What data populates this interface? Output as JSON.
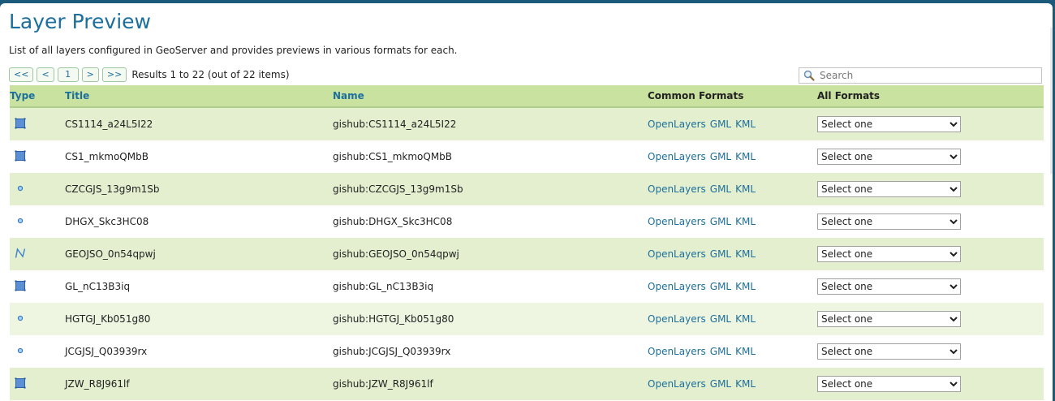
{
  "page": {
    "title": "Layer Preview",
    "description": "List of all layers configured in GeoServer and provides previews in various formats for each."
  },
  "pager": {
    "first": "<<",
    "prev": "<",
    "page": "1",
    "next": ">",
    "last": ">>",
    "results": "Results 1 to 22 (out of 22 items)"
  },
  "search": {
    "placeholder": "Search",
    "icon": "magnifier-icon"
  },
  "table": {
    "headers": {
      "type": "Type",
      "title": "Title",
      "name": "Name",
      "common_formats": "Common Formats",
      "all_formats": "All Formats"
    },
    "format_links": {
      "openlayers": "OpenLayers",
      "gml": "GML",
      "kml": "KML"
    },
    "select_default": "Select one",
    "rows": [
      {
        "type_icon": "polygon-layer-icon",
        "title": "CS1114_a24L5I22",
        "name": "gishub:CS1114_a24L5I22"
      },
      {
        "type_icon": "polygon-layer-icon",
        "title": "CS1_mkmoQMbB",
        "name": "gishub:CS1_mkmoQMbB"
      },
      {
        "type_icon": "point-layer-icon",
        "title": "CZCGJS_13g9m1Sb",
        "name": "gishub:CZCGJS_13g9m1Sb"
      },
      {
        "type_icon": "point-layer-icon",
        "title": "DHGX_Skc3HC08",
        "name": "gishub:DHGX_Skc3HC08"
      },
      {
        "type_icon": "line-layer-icon",
        "title": "GEOJSO_0n54qpwj",
        "name": "gishub:GEOJSO_0n54qpwj"
      },
      {
        "type_icon": "polygon-layer-icon",
        "title": "GL_nC13B3iq",
        "name": "gishub:GL_nC13B3iq"
      },
      {
        "type_icon": "point-layer-icon",
        "title": "HGTGJ_Kb051g80",
        "name": "gishub:HGTGJ_Kb051g80"
      },
      {
        "type_icon": "point-layer-icon",
        "title": "JCGJSJ_Q03939rx",
        "name": "gishub:JCGJSJ_Q03939rx"
      },
      {
        "type_icon": "polygon-layer-icon",
        "title": "JZW_R8J961lf",
        "name": "gishub:JZW_R8J961lf"
      }
    ]
  },
  "colors": {
    "accent": "#1c6f9c",
    "header_bg": "#c9e2a0",
    "row_odd": "#e3efcf",
    "frame": "#1b5a7a"
  }
}
